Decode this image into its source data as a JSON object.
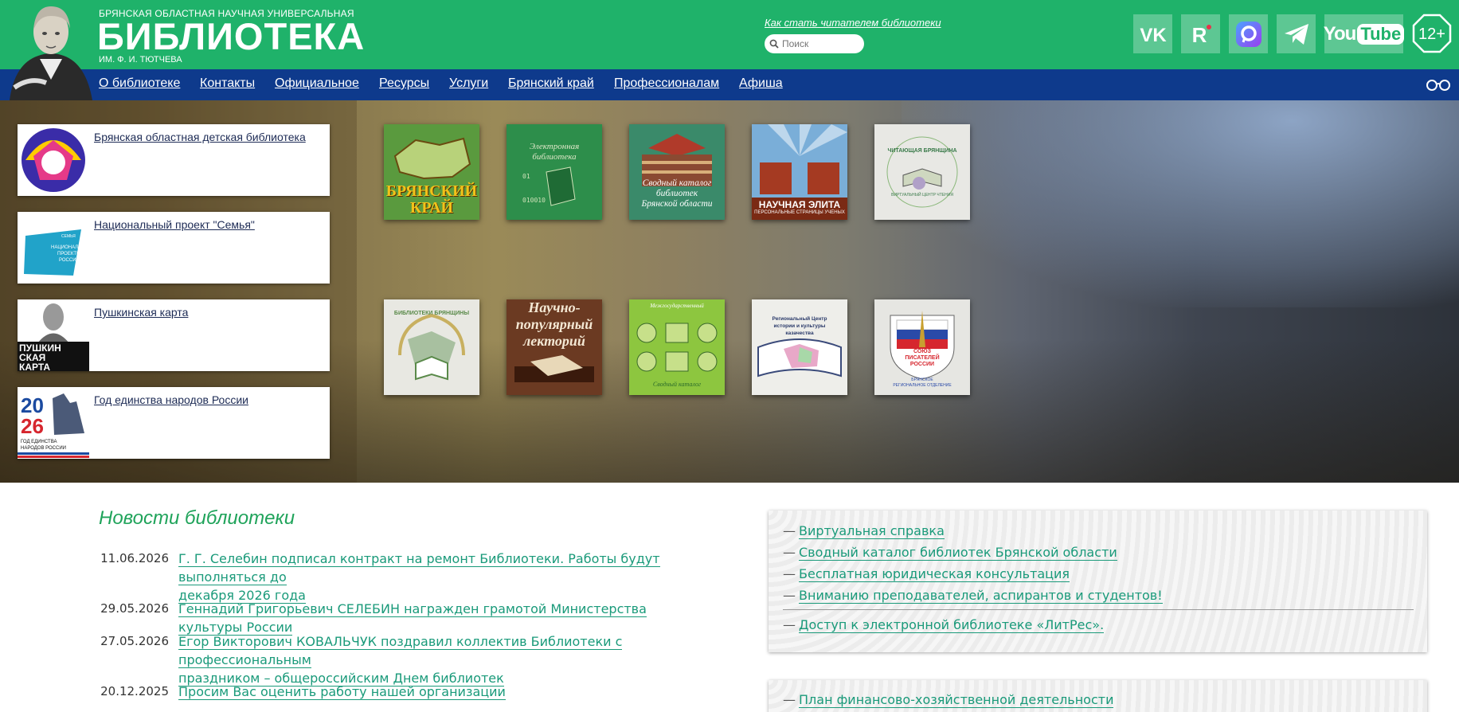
{
  "header": {
    "logo_top": "БРЯНСКАЯ ОБЛАСТНАЯ НАУЧНАЯ УНИВЕРСАЛЬНАЯ",
    "logo_main": "БИБЛИОТЕКА",
    "logo_sub": "ИМ. Ф. И. ТЮТЧЕВА",
    "reader_link": "Как стать читателем библиотеки",
    "search_placeholder": "Поиск",
    "social": [
      "vk-icon",
      "rutube-icon",
      "max-icon",
      "telegram-icon",
      "youtube-icon"
    ],
    "youtube_label": "YouTube",
    "age_rating": "12+",
    "brand_green": "#1fb26a",
    "nav_blue": "#0e3a8c"
  },
  "nav": {
    "items": [
      "О библиотеке",
      "Контакты",
      "Официальное",
      "Ресурсы",
      "Услуги",
      "Брянский край",
      "Профессионалам",
      "Афиша"
    ]
  },
  "cards": [
    {
      "label": "Брянская областная детская библиотека"
    },
    {
      "label": "Национальный проект \"Семья\"",
      "thumb_text": "СЕМЬЯ НАЦИОНАЛЬНЫЕ ПРОЕКТЫ РОССИИ"
    },
    {
      "label": "Пушкинская карта",
      "thumb_text": [
        "ПУШКИН",
        "СКАЯ",
        "КАРТА"
      ]
    },
    {
      "label": "Год единства народов России",
      "thumb_year": [
        "20",
        "26"
      ],
      "thumb_text": "ГОД ЕДИНСТВА НАРОДОВ РОССИИ"
    }
  ],
  "tiles": {
    "row1": [
      {
        "text": [
          "БРЯНСКИЙ",
          "КРАЙ"
        ]
      },
      {
        "text": [
          "Электронная",
          "библиотека"
        ]
      },
      {
        "text": [
          "Сводный каталог",
          "библиотек",
          "Брянской области"
        ]
      },
      {
        "text": [
          "НАУЧНАЯ ЭЛИТА",
          "ПЕРСОНАЛЬНЫЕ СТРАНИЦЫ УЧЕНЫХ"
        ]
      },
      {
        "text": [
          "ЧИТАЮЩАЯ БРЯНЩИНА",
          "ВИРТУАЛЬНЫЙ ЦЕНТР ЧТЕНИЯ"
        ]
      }
    ],
    "row2": [
      {
        "text": [
          "БИБЛИОТЕКИ БРЯНЩИНЫ"
        ]
      },
      {
        "text": [
          "Научно-",
          "популярный",
          "лекторий"
        ]
      },
      {
        "text": [
          "Сводный каталог"
        ]
      },
      {
        "text": [
          "Региональный Центр",
          "истории и культуры",
          "казачества"
        ]
      },
      {
        "text": [
          "СОЮЗ",
          "ПИСАТЕЛЕЙ",
          "РОССИИ",
          "БРЯНСКОЕ",
          "РЕГИОНАЛЬНОЕ ОТДЕЛЕНИЕ"
        ]
      }
    ]
  },
  "news": {
    "title": "Новости библиотеки",
    "items": [
      {
        "date": "11.06.2026",
        "line1": "Г. Г. Селебин подписал контракт на ремонт Библиотеки. Работы будут выполняться до",
        "line2": "декабря 2026 года"
      },
      {
        "date": "29.05.2026",
        "line1": "Геннадий Григорьевич СЕЛЕБИН награжден грамотой Министерства культуры России",
        "line2": ""
      },
      {
        "date": "27.05.2026",
        "line1": "Егор Викторович КОВАЛЬЧУК поздравил коллектив Библиотеки с профессиональным",
        "line2": "праздником – общероссийским Днем библиотек"
      },
      {
        "date": "20.12.2025",
        "line1": "Просим Вас оценить работу нашей организации",
        "line2": ""
      }
    ]
  },
  "panel1": {
    "items": [
      "Виртуальная справка",
      "Сводный каталог библиотек Брянской области",
      "Бесплатная юридическая консультация",
      "Вниманию преподавателей, аспирантов и студентов!",
      "Доступ к электронной библиотеке «ЛитРес»."
    ]
  },
  "panel2": {
    "items": [
      "План финансово-хозяйственной деятельности"
    ]
  }
}
